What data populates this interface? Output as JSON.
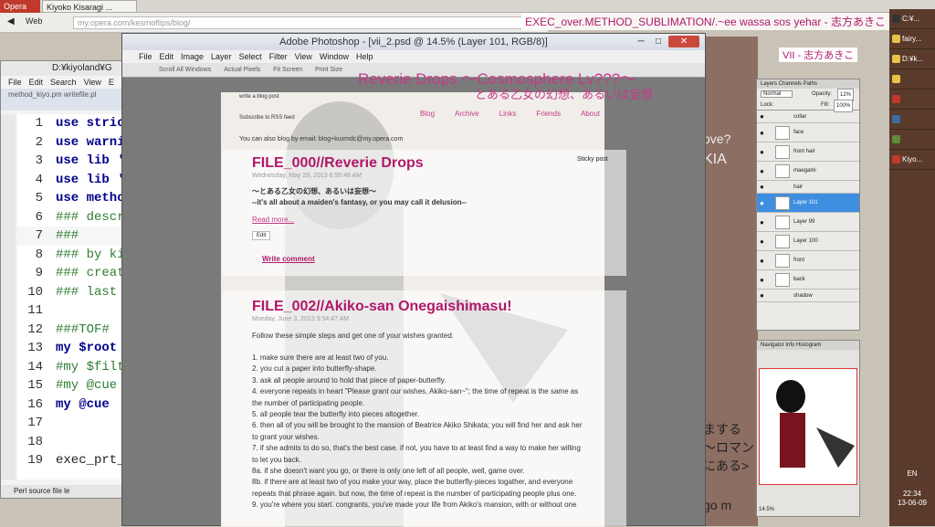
{
  "opera": {
    "menu": "Opera",
    "tab1": "Kiyoko Kisaragi ...",
    "tab2": "×",
    "back_label": "Web",
    "url": "my.opera.com/kesmoflips/blog/"
  },
  "caption": "EXEC_over.METHOD_SUBLIMATION/.~ee wassa sos yehar - 志方あきこ",
  "editor": {
    "title": "D:¥kiyoland¥G",
    "menu": [
      "File",
      "Edit",
      "Search",
      "View",
      "E"
    ],
    "tabs": "method_kiyo.pm    writefile.pl",
    "status": "Perl source file      le",
    "lines": [
      {
        "n": "1",
        "t": "use strict;"
      },
      {
        "n": "2",
        "t": "use warni"
      },
      {
        "n": "3",
        "t": "use lib 'D:"
      },
      {
        "n": "4",
        "t": "use lib 'c:¥"
      },
      {
        "n": "5",
        "t": "use metho"
      },
      {
        "n": "6",
        "t": "### descr"
      },
      {
        "n": "7",
        "t": "###"
      },
      {
        "n": "8",
        "t": "### by ki"
      },
      {
        "n": "9",
        "t": "### creat"
      },
      {
        "n": "10",
        "t": "### last m"
      },
      {
        "n": "11",
        "t": ""
      },
      {
        "n": "12",
        "t": "###TOF#"
      },
      {
        "n": "13",
        "t": "my $root ="
      },
      {
        "n": "14",
        "t": "#my $filte"
      },
      {
        "n": "15",
        "t": "#my @cue"
      },
      {
        "n": "16",
        "t": "my @cue"
      },
      {
        "n": "17",
        "t": ""
      },
      {
        "n": "18",
        "t": ""
      },
      {
        "n": "19",
        "t": "exec_prt_a"
      }
    ]
  },
  "ps": {
    "title": "Adobe Photoshop - [vii_2.psd @ 14.5% (Layer 101, RGB/8)]",
    "menu": [
      "File",
      "Edit",
      "Image",
      "Layer",
      "Select",
      "Filter",
      "View",
      "Window",
      "Help"
    ],
    "opts": [
      "Scroll All Windows",
      "Actual Pixels",
      "Fit Screen",
      "Print Size"
    ]
  },
  "blog": {
    "title": "Reverie Drops ～Cosmosphere Lv???～",
    "subtitle": "とある乙女の幻想、あるいは妄想",
    "write_post": "write a blog post",
    "rss": "Subscribe to RSS feed",
    "email_note": "You can also blog by email: blog+kuxmdc@my.opera.com",
    "sticky": "Sticky post",
    "nav": [
      "Blog",
      "Archive",
      "Links",
      "Friends",
      "About"
    ],
    "post1": {
      "title": "FILE_000//Reverie Drops",
      "date": "Wednesday, May 29, 2013 6:55:48 AM",
      "line1": "～とある乙女の幻想、あるいは妄想～",
      "line2": "--it's all about a maiden's fantasy, or you may call it delusion--",
      "read_more": "Read more...",
      "edit": "Edit",
      "comment": "Write comment"
    },
    "post2": {
      "title": "FILE_002//Akiko-san Onegaishimasu!",
      "date": "Monday, June 3, 2013 9:54:47 AM",
      "intro": "Follow these simple steps and get one of your wishes granted.",
      "steps": [
        "1. make sure there are at least two of you.",
        "2. you cut a paper into butterfly-shape.",
        "3. ask all people around to hold that piece of paper-butterfly.",
        "4. everyone repeats in heart \"Please grant our wishes, Akiko-san~\"; the time of repeat is the same as",
        "the number of participating people.",
        "5. all people tear the butterfly into pieces altogether.",
        "6. then all of you will be brought to the mansion of Beatrice Akiko Shikata; you will find her and ask her",
        "to grant your wishes.",
        "7. if she admits to do so, that's the best case. if not, you have to at least find a way to make her willing",
        "to let you back.",
        "8a. if she doesn't want you go, or there is only one left of all people, well, game over.",
        "8b. if there are at least two of you make your way, place the butterfly-pieces togather, and everyone",
        "repeats that phrase again. but now, the time of repeat is the number of participating people plus one.",
        "9. you're where you start. congrants, you've made your life from Akiko's mansion, with or without one"
      ]
    }
  },
  "layers": {
    "tabs": "Layers  Channels  Paths",
    "blend": "Normal",
    "opacity_label": "Opacity:",
    "opacity": "12%",
    "lock": "Lock:",
    "fill_label": "Fill:",
    "fill": "100%",
    "items": [
      "collar",
      "face",
      "front hair",
      "maegami",
      "hair",
      "Layer 101",
      "Layer 99",
      "Layer 100",
      "front",
      "back",
      "shadow"
    ]
  },
  "navigator": {
    "tabs": "Navigator  Info  Histogram",
    "zoom": "14.5%"
  },
  "desktop": {
    "label_vii": "VII - 志方あきこ",
    "bg1": "ove?",
    "bg2": "KIA",
    "jp1": "まする",
    "jp2": "～ロマン",
    "jp3": "にある>",
    "jp4": "go m"
  },
  "taskbar": {
    "items": [
      "C:¥...",
      "fairy...",
      "D:¥k...",
      "",
      "",
      "",
      "",
      "Kiyo..."
    ],
    "lang": "EN",
    "time": "22:34",
    "date": "13-06-09"
  }
}
